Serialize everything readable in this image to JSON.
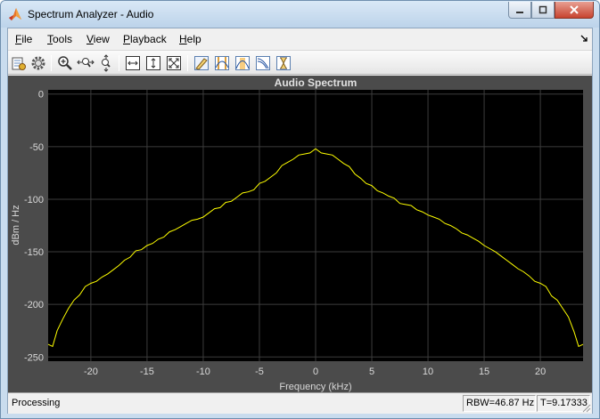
{
  "window": {
    "title": "Spectrum Analyzer - Audio"
  },
  "menu": [
    {
      "label": "File",
      "accel": "F",
      "rest": "ile"
    },
    {
      "label": "Tools",
      "accel": "T",
      "rest": "ools"
    },
    {
      "label": "View",
      "accel": "V",
      "rest": "iew"
    },
    {
      "label": "Playback",
      "accel": "P",
      "rest": "layback"
    },
    {
      "label": "Help",
      "accel": "H",
      "rest": "elp"
    }
  ],
  "toolbar": {
    "buttons": [
      "settings-tool",
      "style-gear",
      "zoom-in",
      "zoom-x",
      "zoom-y",
      "scale-x",
      "scale-y",
      "scale-xy",
      "peak-finder",
      "cursor-measurements",
      "channel-measurements",
      "distortion",
      "ccdf"
    ]
  },
  "status": {
    "left": "Processing",
    "rbw": "RBW=46.87 Hz",
    "time": "T=9.17333"
  },
  "chart_data": {
    "type": "line",
    "title": "Audio Spectrum",
    "xlabel": "Frequency (kHz)",
    "ylabel": "dBm / Hz",
    "xlim": [
      -23.8,
      23.8
    ],
    "ylim": [
      -254,
      4
    ],
    "xticks": [
      -20,
      -15,
      -10,
      -5,
      0,
      5,
      10,
      15,
      20
    ],
    "yticks": [
      0,
      -50,
      -100,
      -150,
      -200,
      -250
    ],
    "grid": true,
    "background": "#000000",
    "series": [
      {
        "color": "#ffff00",
        "x": [
          -23.8,
          -23.4,
          -23.0,
          -22.5,
          -22.0,
          -21.5,
          -21.0,
          -20.5,
          -20.0,
          -19.5,
          -19.0,
          -18.5,
          -18.0,
          -17.5,
          -17.0,
          -16.5,
          -16.0,
          -15.5,
          -15.0,
          -14.5,
          -14.0,
          -13.5,
          -13.0,
          -12.5,
          -12.0,
          -11.5,
          -11.0,
          -10.5,
          -10.0,
          -9.5,
          -9.0,
          -8.5,
          -8.0,
          -7.5,
          -7.0,
          -6.5,
          -6.0,
          -5.5,
          -5.0,
          -4.5,
          -4.0,
          -3.5,
          -3.0,
          -2.5,
          -2.0,
          -1.5,
          -1.0,
          -0.5,
          0.0,
          0.5,
          1.0,
          1.5,
          2.0,
          2.5,
          3.0,
          3.5,
          4.0,
          4.5,
          5.0,
          5.5,
          6.0,
          6.5,
          7.0,
          7.5,
          8.0,
          8.5,
          9.0,
          9.5,
          10.0,
          10.5,
          11.0,
          11.5,
          12.0,
          12.5,
          13.0,
          13.5,
          14.0,
          14.5,
          15.0,
          15.5,
          16.0,
          16.5,
          17.0,
          17.5,
          18.0,
          18.5,
          19.0,
          19.5,
          20.0,
          20.5,
          21.0,
          21.5,
          22.0,
          22.5,
          23.0,
          23.4,
          23.8
        ],
        "values": [
          -238,
          -240,
          -225,
          -214,
          -204,
          -196,
          -191,
          -183,
          -180,
          -178,
          -174,
          -171,
          -167,
          -163,
          -158,
          -155,
          -149,
          -148,
          -144,
          -142,
          -138,
          -136,
          -131,
          -129,
          -126,
          -123,
          -120,
          -119,
          -117,
          -113,
          -109,
          -108,
          -103,
          -102,
          -98,
          -94,
          -93,
          -91,
          -85,
          -83,
          -79,
          -75,
          -68,
          -65,
          -62,
          -58,
          -57,
          -56,
          -52,
          -56,
          -57,
          -58,
          -62,
          -66,
          -69,
          -76,
          -80,
          -85,
          -87,
          -92,
          -94,
          -97,
          -99,
          -104,
          -105,
          -106,
          -110,
          -112,
          -115,
          -117,
          -119,
          -123,
          -125,
          -128,
          -132,
          -134,
          -137,
          -140,
          -144,
          -147,
          -150,
          -154,
          -158,
          -162,
          -166,
          -169,
          -173,
          -178,
          -180,
          -183,
          -192,
          -196,
          -204,
          -212,
          -226,
          -240,
          -238
        ]
      }
    ]
  }
}
